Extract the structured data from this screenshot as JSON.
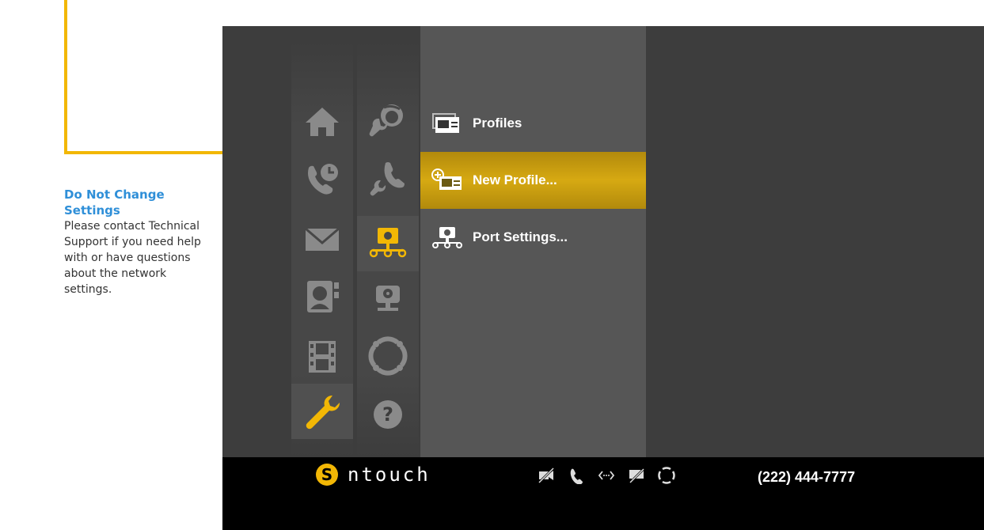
{
  "callout": {
    "title": "Do Not Change Settings",
    "body": "Please contact Technical Support if you need help with or have questions about the network settings."
  },
  "colors": {
    "accent": "#f2b705",
    "selected": "#d6a912",
    "callout_title": "#2f8fd8",
    "screen_bg": "#3d3d3d"
  },
  "nav_primary": [
    {
      "icon": "home-icon"
    },
    {
      "icon": "call-history-icon"
    },
    {
      "icon": "mail-icon"
    },
    {
      "icon": "contacts-icon"
    },
    {
      "icon": "video-center-icon"
    },
    {
      "icon": "settings-wrench-icon",
      "selected": true
    }
  ],
  "nav_secondary": [
    {
      "icon": "personal-settings-icon"
    },
    {
      "icon": "call-settings-icon"
    },
    {
      "icon": "network-settings-icon",
      "selected": true
    },
    {
      "icon": "camera-settings-icon"
    },
    {
      "icon": "remote-control-icon"
    },
    {
      "icon": "help-icon"
    }
  ],
  "menu": [
    {
      "label": "Profiles",
      "icon": "profiles-icon"
    },
    {
      "label": "New Profile...",
      "icon": "new-profile-icon",
      "active": true
    },
    {
      "label": "Port Settings...",
      "icon": "port-settings-icon"
    }
  ],
  "footer": {
    "brand": "ntouch",
    "brand_mark": "S",
    "status_icons": [
      "video-off-icon",
      "phone-icon",
      "network-icon",
      "no-message-icon",
      "remote-icon"
    ],
    "phone_number": "(222) 444-7777"
  }
}
